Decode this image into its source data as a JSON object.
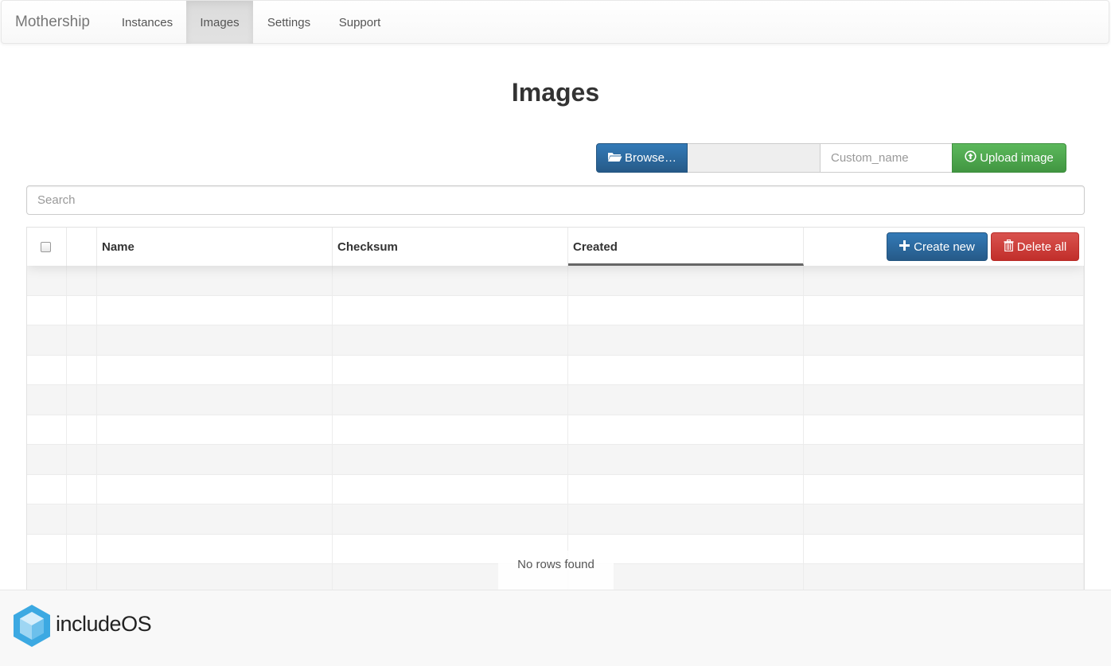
{
  "navbar": {
    "brand": "Mothership",
    "items": [
      {
        "label": "Instances",
        "active": false
      },
      {
        "label": "Images",
        "active": true
      },
      {
        "label": "Settings",
        "active": false
      },
      {
        "label": "Support",
        "active": false
      }
    ]
  },
  "page": {
    "title": "Images"
  },
  "upload": {
    "browse_label": "Browse…",
    "file_value": "",
    "custom_name_placeholder": "Custom_name",
    "upload_label": "Upload image"
  },
  "search": {
    "placeholder": "Search"
  },
  "table": {
    "columns": [
      "",
      "",
      "Name",
      "Checksum",
      "Created"
    ],
    "sorted_column": "Created",
    "create_label": "Create new",
    "delete_label": "Delete all",
    "rows": [],
    "empty_text": "No rows found"
  },
  "footer": {
    "logo_text_main": "include",
    "logo_text_suffix": "OS"
  },
  "colors": {
    "primary": "#337ab7",
    "success": "#5cb85c",
    "danger": "#d9534f",
    "logo_blue": "#3ca9e2"
  }
}
